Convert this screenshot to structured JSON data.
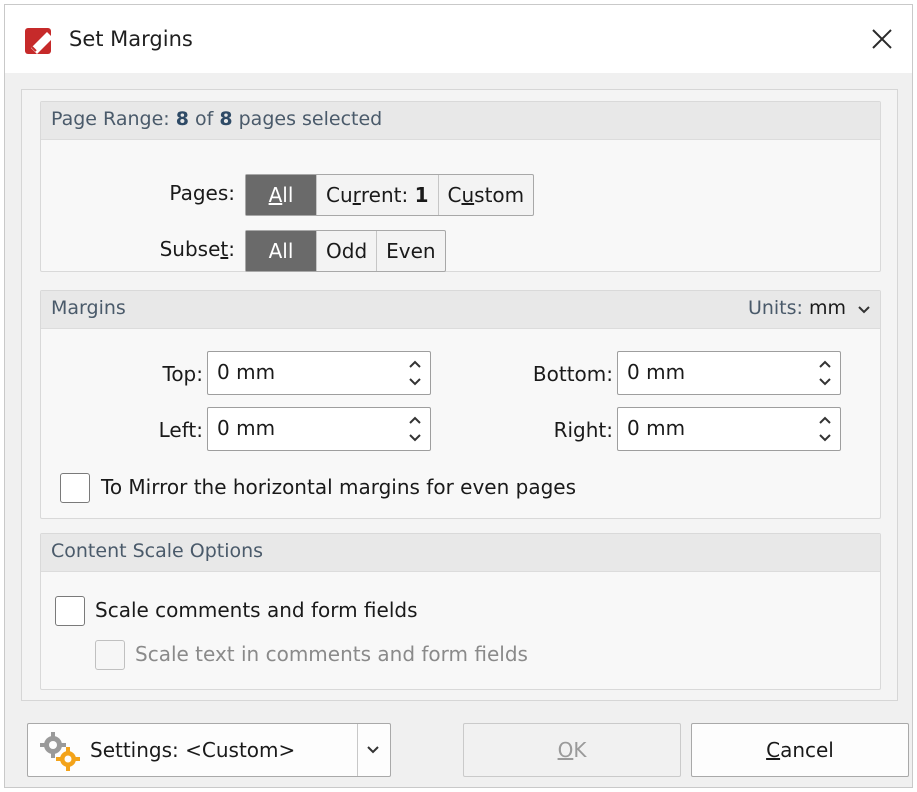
{
  "window": {
    "title": "Set Margins"
  },
  "page_range": {
    "prefix": "Page Range: ",
    "selected": "8",
    "of": " of ",
    "total": "8",
    "suffix": " pages selected",
    "pages_label_before": "Pages",
    "pages_label_after": ":",
    "pages_options": [
      {
        "pre": "",
        "ul": "A",
        "post": "ll"
      },
      {
        "pre": "Cu",
        "ul": "r",
        "post": "rent: ",
        "bold": "1"
      },
      {
        "pre": "C",
        "ul": "u",
        "post": "stom"
      }
    ],
    "subset_label_pre": "Subse",
    "subset_label_ul": "t",
    "subset_label_post": ":",
    "subset_options": [
      "All",
      "Odd",
      "Even"
    ]
  },
  "margins": {
    "header": "Margins",
    "units_label": "Units: ",
    "units_value": "mm",
    "top_label": "Top:",
    "top_value": "0 mm",
    "left_label": "Left:",
    "left_value": "0 mm",
    "bottom_label": "Bottom:",
    "bottom_value": "0 mm",
    "right_label": "Right:",
    "right_value": "0 mm",
    "mirror_label": "To Mirror the horizontal margins for even pages"
  },
  "content_scale": {
    "header": "Content Scale Options",
    "scale_fields_label": "Scale comments and form fields",
    "scale_text_label": "Scale text in comments and form fields"
  },
  "footer": {
    "settings_label": "Settings: <Custom>",
    "ok_pre": "",
    "ok_ul": "O",
    "ok_post": "K",
    "cancel_pre": "",
    "cancel_ul": "C",
    "cancel_post": "ancel"
  },
  "colors": {
    "active_segment": "#6a6a6a",
    "accent_red": "#c62a2a"
  }
}
